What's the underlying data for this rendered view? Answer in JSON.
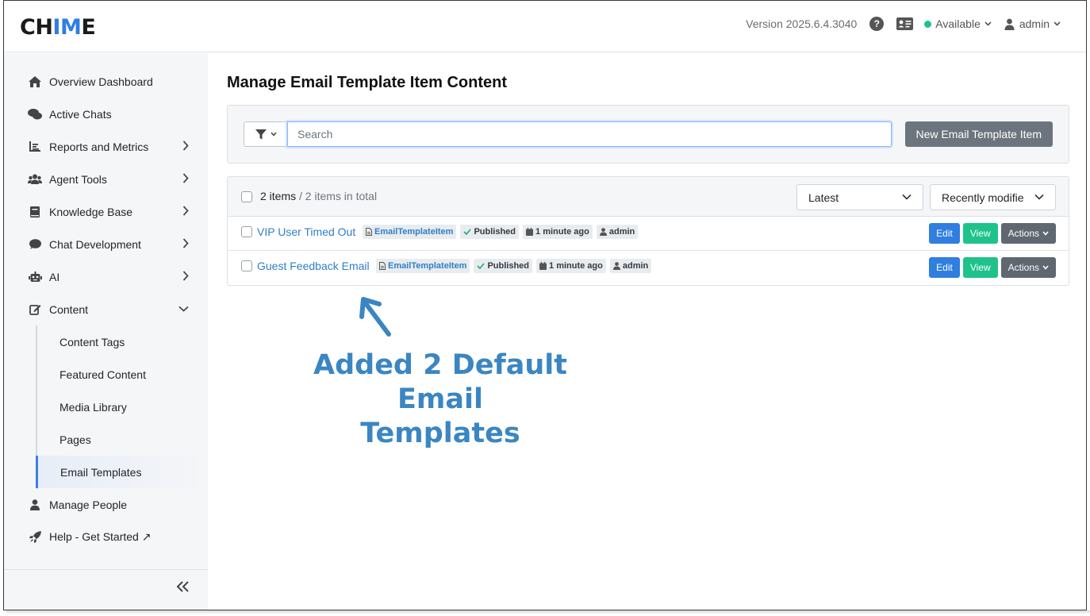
{
  "header": {
    "logo_pre": "CH",
    "logo_hi": "IM",
    "logo_post": "E",
    "version": "Version 2025.6.4.3040",
    "status": "Available",
    "user": "admin"
  },
  "sidebar": {
    "items": [
      {
        "label": "Overview Dashboard",
        "icon": "home-icon"
      },
      {
        "label": "Active Chats",
        "icon": "chats-icon"
      },
      {
        "label": "Reports and Metrics",
        "icon": "chart-icon"
      },
      {
        "label": "Agent Tools",
        "icon": "users-icon"
      },
      {
        "label": "Knowledge Base",
        "icon": "book-icon"
      },
      {
        "label": "Chat Development",
        "icon": "chat-bubble-icon"
      },
      {
        "label": "AI",
        "icon": "robot-icon"
      },
      {
        "label": "Content",
        "icon": "edit-icon"
      }
    ],
    "content_sub": [
      {
        "label": "Content Tags"
      },
      {
        "label": "Featured Content"
      },
      {
        "label": "Media Library"
      },
      {
        "label": "Pages"
      },
      {
        "label": "Email Templates"
      }
    ],
    "bottom_items": [
      {
        "label": "Manage People",
        "icon": "person-icon"
      },
      {
        "label": "Help - Get Started ↗",
        "icon": "rocket-icon"
      }
    ]
  },
  "main": {
    "title": "Manage Email Template Item Content",
    "search_placeholder": "Search",
    "new_button": "New Email Template Item",
    "count": "2 items",
    "count_total": " / 2 items in total",
    "sort_select": "Latest",
    "order_select": "Recently modifie",
    "rows": [
      {
        "title": "VIP User Timed Out",
        "type": "EmailTemplateItem",
        "status": "Published",
        "time": "1 minute ago",
        "author": "admin"
      },
      {
        "title": "Guest Feedback Email",
        "type": "EmailTemplateItem",
        "status": "Published",
        "time": "1 minute ago",
        "author": "admin"
      }
    ],
    "edit_label": "Edit",
    "view_label": "View",
    "actions_label": "Actions"
  },
  "annotation": {
    "line1": "Added 2 Default Email",
    "line2": "Templates"
  },
  "colors": {
    "accent": "#2f7ee0",
    "success": "#1fc28b",
    "annotation": "#3b86c2"
  }
}
